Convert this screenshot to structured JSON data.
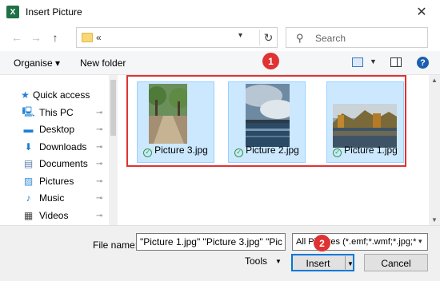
{
  "window": {
    "title": "Insert Picture",
    "app_icon": "excel-icon",
    "close_glyph": "✕"
  },
  "address_bar": {
    "path": "«",
    "back_glyph": "←",
    "forward_glyph": "→",
    "up_glyph": "↑",
    "refresh_glyph": "↻"
  },
  "search": {
    "placeholder": "Search"
  },
  "toolbar": {
    "organise_label": "Organise ▾",
    "new_folder_label": "New folder",
    "help_glyph": "?"
  },
  "nav": {
    "items": [
      {
        "label": "Quick access",
        "icon": "star-icon",
        "glyph": "★",
        "color": "#1c7fd6"
      },
      {
        "label": "This PC",
        "icon": "computer-icon",
        "glyph": "🖳",
        "color": "#1c7fd6"
      },
      {
        "label": "Desktop",
        "icon": "desktop-icon",
        "glyph": "▬",
        "color": "#1c7fd6"
      },
      {
        "label": "Downloads",
        "icon": "download-icon",
        "glyph": "⬇",
        "color": "#1c7fd6"
      },
      {
        "label": "Documents",
        "icon": "document-icon",
        "glyph": "▤",
        "color": "#5a7fa8"
      },
      {
        "label": "Pictures",
        "icon": "picture-icon",
        "glyph": "▨",
        "color": "#3a8fd6"
      },
      {
        "label": "Music",
        "icon": "music-icon",
        "glyph": "♪",
        "color": "#1c7fd6"
      },
      {
        "label": "Videos",
        "icon": "video-icon",
        "glyph": "▦",
        "color": "#444444"
      }
    ],
    "pin_glyph": "📌"
  },
  "files": [
    {
      "name": "Picture 3.jpg",
      "status_icon": "sync-check-icon"
    },
    {
      "name": "Picture 2.jpg",
      "status_icon": "sync-check-icon"
    },
    {
      "name": "Picture 1.jpg",
      "status_icon": "sync-check-icon"
    }
  ],
  "annotations": {
    "badge_1": "1",
    "badge_2": "2",
    "highlight_color": "#e03232"
  },
  "bottom": {
    "file_name_label": "File name:",
    "file_name_value": "\"Picture 1.jpg\" \"Picture 3.jpg\" \"Pic",
    "file_type_value": "All Pictures (*.emf;*.wmf;*.jpg;*",
    "tools_label": "Tools",
    "insert_label": "Insert",
    "cancel_label": "Cancel"
  }
}
